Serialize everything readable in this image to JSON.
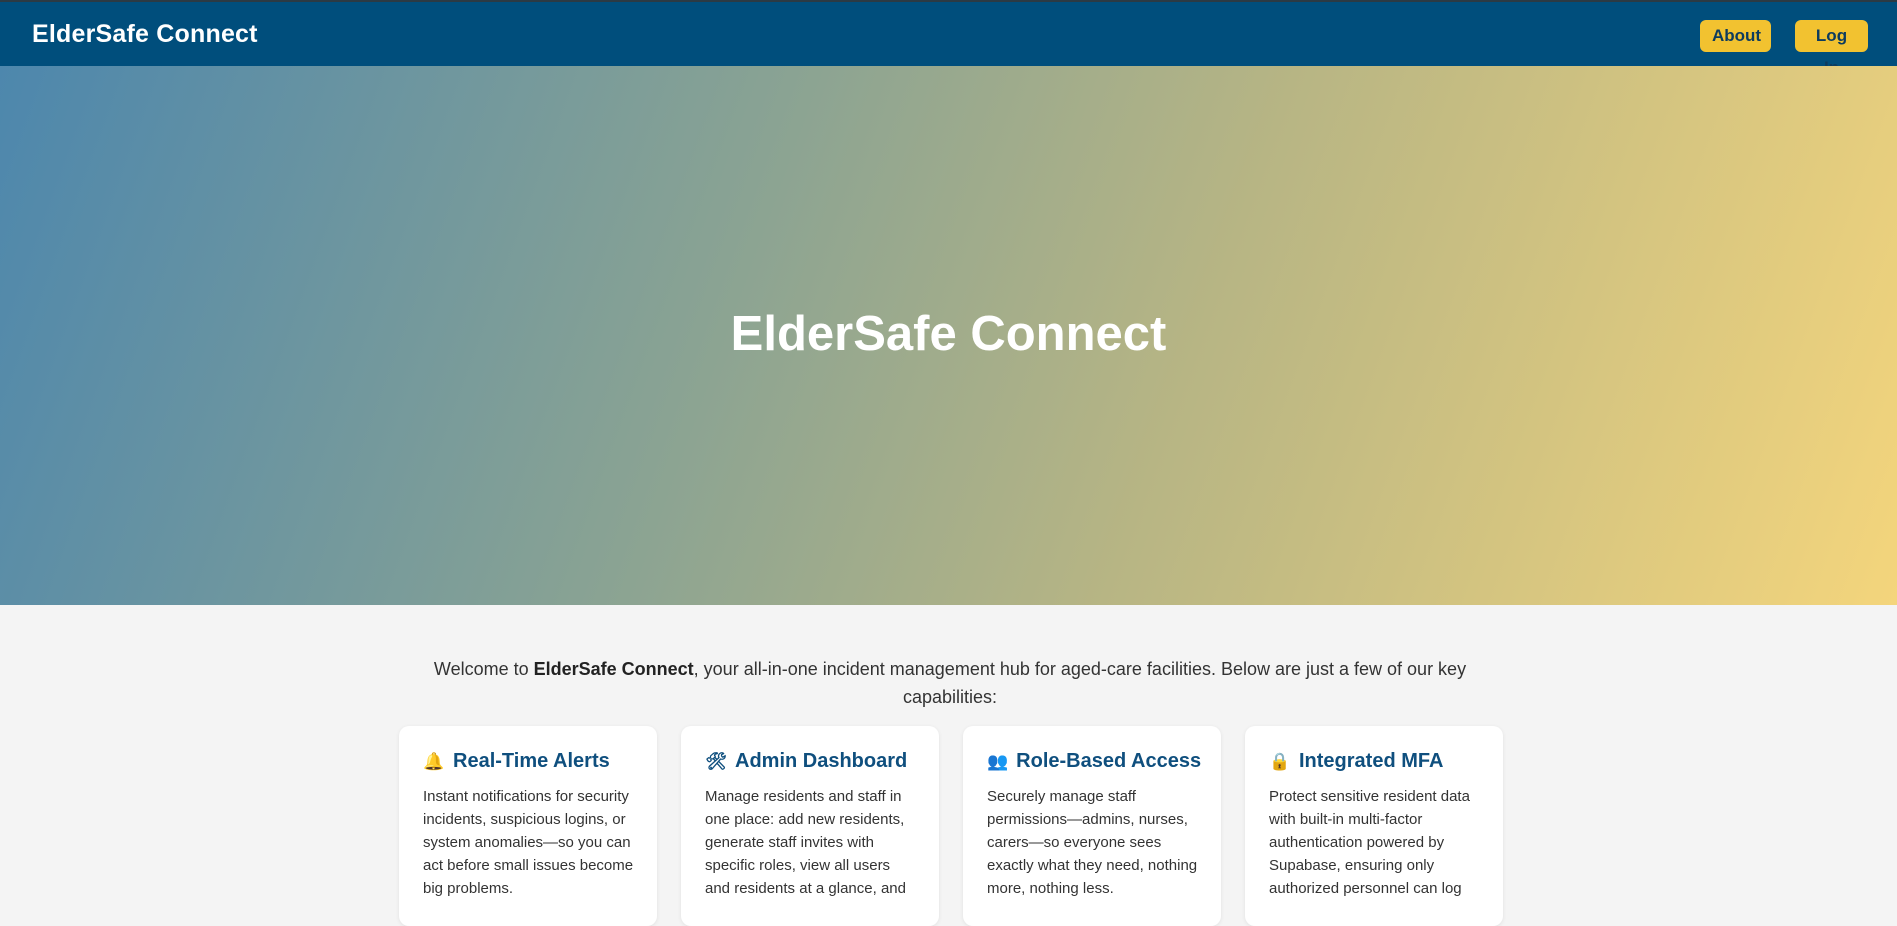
{
  "header": {
    "brand": "ElderSafe Connect",
    "about_label": "About",
    "login_label": "Log In"
  },
  "hero": {
    "title": "ElderSafe Connect"
  },
  "intro": {
    "prefix": "Welcome to ",
    "brand": "ElderSafe Connect",
    "suffix": ", your all-in-one incident management hub for aged-care facilities. Below are just a few of our key capabilities:"
  },
  "features": [
    {
      "icon": "bell-icon",
      "glyph": "🔔",
      "title": "Real-Time Alerts",
      "text": "Instant notifications for security incidents, suspicious logins, or system anomalies—so you can act before small issues become big problems."
    },
    {
      "icon": "tools-icon",
      "glyph": "🛠",
      "title": "Admin Dashboard",
      "text": "Manage residents and staff in one place: add new residents, generate staff invites with specific roles, view all users and residents at a glance, and"
    },
    {
      "icon": "users-icon",
      "glyph": "👥",
      "title": "Role-Based Access",
      "text": "Securely manage staff permissions—admins, nurses, carers—so everyone sees exactly what they need, nothing more, nothing less."
    },
    {
      "icon": "lock-icon",
      "glyph": "🔒",
      "title": "Integrated MFA",
      "text": "Protect sensitive resident data with built-in multi-factor authentication powered by Supabase, ensuring only authorized personnel can log"
    }
  ],
  "colors": {
    "header_bg": "#004e7c",
    "button_bg": "#f2c230",
    "card_title": "#0f4f7e",
    "page_bg": "#f4f4f4"
  }
}
